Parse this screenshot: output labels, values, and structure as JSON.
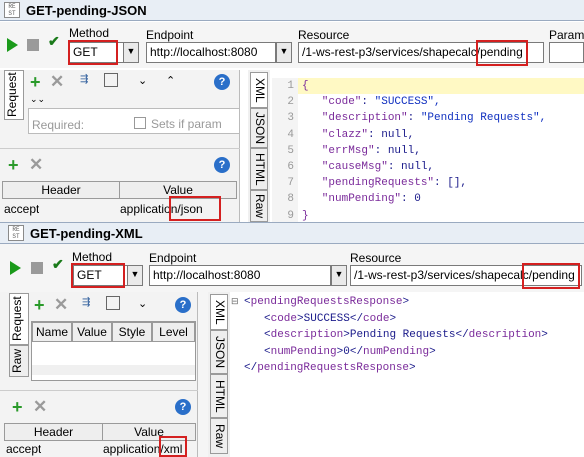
{
  "win1": {
    "title": "GET-pending-JSON",
    "method_label": "Method",
    "method": "GET",
    "endpoint_label": "Endpoint",
    "endpoint": "http://localhost:8080",
    "resource_label": "Resource",
    "resource_main": "/1-ws-rest-p3/services/shapecalc/",
    "resource_tail": "pending",
    "params_label": "Param",
    "req_tab": "Request",
    "required_label": "Required:",
    "sets_if_label": "Sets if param",
    "header_col": "Header",
    "value_col": "Value",
    "row_header": "accept",
    "row_value_main": "application",
    "row_value_tail": "/json",
    "resp_tabs": [
      "XML",
      "JSON",
      "HTML",
      "Raw"
    ],
    "line_numbers": [
      "1",
      "2",
      "3",
      "4",
      "5",
      "6",
      "7",
      "8",
      "9"
    ],
    "code_lines": [
      "{",
      "   \"code\": \"SUCCESS\",",
      "   \"description\": \"Pending Requests\",",
      "   \"clazz\": null,",
      "   \"errMsg\": null,",
      "   \"causeMsg\": null,",
      "   \"pendingRequests\": [],",
      "   \"numPending\": 0",
      "}"
    ]
  },
  "win2": {
    "title": "GET-pending-XML",
    "method_label": "Method",
    "method": "GET",
    "endpoint_label": "Endpoint",
    "endpoint": "http://localhost:8080",
    "resource_label": "Resource",
    "resource_main": "/1-ws-rest-p3/services/shapecalc/",
    "resource_tail": "pending",
    "req_tab": "Request",
    "raw_tab": "Raw",
    "param_cols": [
      "Name",
      "Value",
      "Style",
      "Level"
    ],
    "header_col": "Header",
    "value_col": "Value",
    "row_header": "accept",
    "row_value_main": "application/",
    "row_value_tail": "xml",
    "resp_tabs": [
      "XML",
      "JSON",
      "HTML",
      "Raw"
    ],
    "xml_lines": [
      {
        "indent": 0,
        "open": "pendingRequestsResponse",
        "text": "",
        "close": ""
      },
      {
        "indent": 1,
        "open": "code",
        "text": "SUCCESS",
        "close": "code"
      },
      {
        "indent": 1,
        "open": "description",
        "text": "Pending Requests",
        "close": "description"
      },
      {
        "indent": 1,
        "open": "numPending",
        "text": "0",
        "close": "numPending"
      },
      {
        "indent": 0,
        "open": "",
        "text": "",
        "close": "pendingRequestsResponse"
      }
    ]
  },
  "colors": {
    "highlight_red": "#d42020",
    "tag_purple": "#7a2a9a",
    "string_blue": "#1030c0"
  }
}
